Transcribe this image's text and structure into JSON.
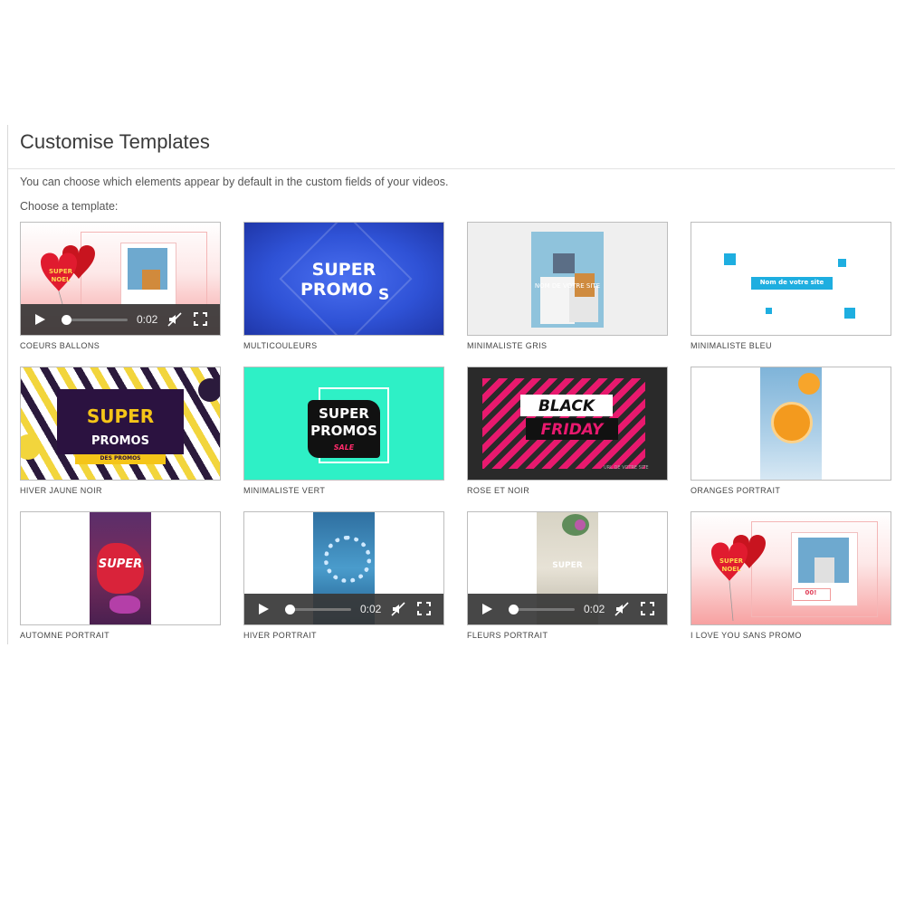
{
  "page": {
    "title": "Customise Templates",
    "description": "You can choose which elements appear by default in the custom fields of your videos.",
    "choose_label": "Choose a template:"
  },
  "player": {
    "time": "0:02",
    "progress": 0.05
  },
  "templates": [
    {
      "label": "COEURS BALLONS",
      "art": {
        "badge": "SUPER\nNOEL"
      }
    },
    {
      "label": "MULTICOULEURS",
      "art": {
        "line1": "SUPER",
        "line2": "PROMO",
        "tail": "S"
      }
    },
    {
      "label": "MINIMALISTE GRIS",
      "art": {
        "caption": "NOM DE VOTRE SITE"
      }
    },
    {
      "label": "MINIMALISTE BLEU",
      "art": {
        "caption": "Nom de votre site"
      }
    },
    {
      "label": "HIVER JAUNE NOIR",
      "art": {
        "line1": "SUPER",
        "line2": "PROMOS",
        "line3": "DES PROMOS"
      }
    },
    {
      "label": "MINIMALISTE VERT",
      "art": {
        "line1": "SUPER",
        "line2": "PROMOS",
        "line3": "SALE"
      }
    },
    {
      "label": "ROSE ET NOIR",
      "art": {
        "line1": "BLACK",
        "line2": "FRIDAY",
        "caption": "URL DE VOTRE SITE"
      }
    },
    {
      "label": "ORANGES PORTRAIT",
      "art": {}
    },
    {
      "label": "AUTOMNE PORTRAIT",
      "art": {
        "line1": "SUPER"
      }
    },
    {
      "label": "HIVER PORTRAIT",
      "art": {}
    },
    {
      "label": "FLEURS PORTRAIT",
      "art": {
        "line1": "SUPER"
      }
    },
    {
      "label": "I LOVE YOU SANS PROMO",
      "art": {
        "badge": "SUPER\nNOEL",
        "tag": "00!"
      }
    }
  ],
  "colors": {
    "controls_bg": "#373737",
    "progress_accent": "#4fb3e8",
    "multicouleurs_bg": "#2f52d6",
    "minimaliste_bleu_accent": "#1eaee0",
    "minimaliste_vert_bg": "#2ef0c6",
    "rose_et_noir_accent": "#e8196e",
    "hiver_jaune_noir_bg": "#2b1240",
    "coeurs_ballons_heart": "#e01b2f"
  },
  "icons": [
    "play-icon",
    "mute-icon",
    "fullscreen-icon"
  ]
}
